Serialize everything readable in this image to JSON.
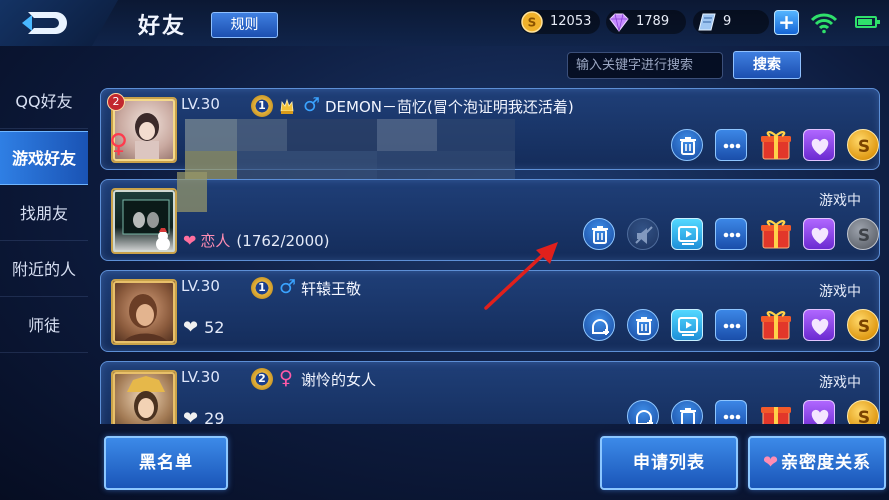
{
  "header": {
    "title": "好友",
    "rules_label": "规则"
  },
  "resources": {
    "coins": "12053",
    "diamonds": "1789",
    "vouchers": "9"
  },
  "search": {
    "placeholder": "输入关键字进行搜索",
    "button_label": "搜索"
  },
  "sidebar": {
    "items": [
      {
        "label": "QQ好友",
        "active": false
      },
      {
        "label": "游戏好友",
        "active": true
      },
      {
        "label": "找朋友",
        "active": false
      },
      {
        "label": "附近的人",
        "active": false
      },
      {
        "label": "师徒",
        "active": false
      }
    ]
  },
  "friends": [
    {
      "level": "LV.30",
      "rank": "1",
      "name": "DEMON－茴忆(冒个泡证明我还活着)",
      "gender": "male",
      "status": "",
      "avatar_badge": "2"
    },
    {
      "level": "",
      "rank": "",
      "name": "",
      "gender": "",
      "status": "游戏中",
      "relation": "恋人",
      "intimacy": "(1762/2000)"
    },
    {
      "level": "LV.30",
      "rank": "1",
      "name": "轩辕王敬",
      "gender": "male",
      "status": "游戏中",
      "hearts": "52"
    },
    {
      "level": "LV.30",
      "rank": "2",
      "name": "谢怜的女人",
      "gender": "female",
      "status": "游戏中",
      "hearts": "29"
    }
  ],
  "glyphs": {
    "male": "♂",
    "female": "♀",
    "heart": "❤",
    "plus": "+"
  },
  "bottom": {
    "blacklist_label": "黑名单",
    "requests_label": "申请列表",
    "intimacy_label": "亲密度关系"
  },
  "colors": {
    "accent": "#2f7fe4",
    "male": "#3aa3ff",
    "female": "#ff5aa8",
    "lover": "#ff8db3",
    "arrow": "#e0201c"
  },
  "icons": [
    "back-arrow-icon",
    "gold-coin-icon",
    "diamond-icon",
    "voucher-icon",
    "wifi-icon",
    "battery-icon",
    "delete-icon",
    "chat-icon",
    "gift-icon",
    "intimacy-heart-icon",
    "gold-gift-coin-icon",
    "video-icon",
    "add-friend-icon",
    "mute-icon"
  ]
}
